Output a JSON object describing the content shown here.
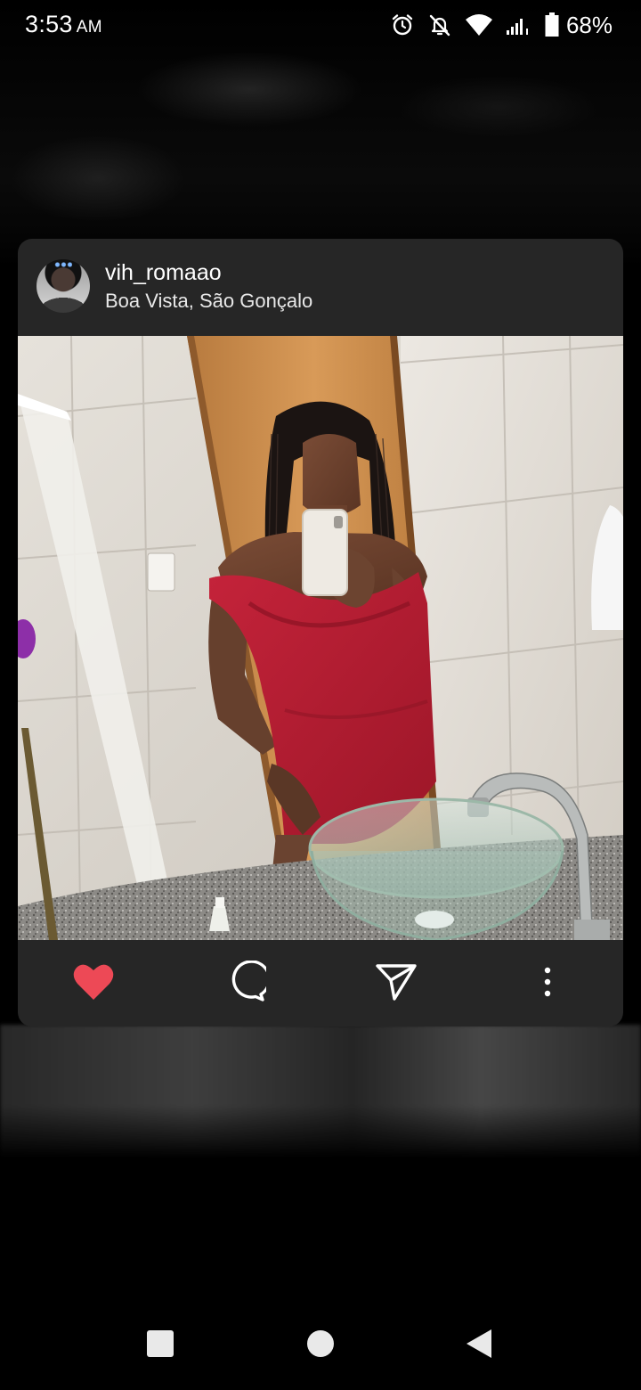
{
  "status_bar": {
    "time": "3:53",
    "ampm": "AM",
    "battery_percent": "68%",
    "icons": [
      "alarm-icon",
      "notifications-off-icon",
      "wifi-icon",
      "signal-icon",
      "battery-icon"
    ]
  },
  "post": {
    "username": "vih_romaao",
    "location": "Boa Vista, São Gonçalo",
    "liked": true,
    "actions": [
      "heart-icon",
      "comment-icon",
      "send-icon",
      "more-icon"
    ],
    "like_color": "#ED4956"
  },
  "nav_bar": {
    "buttons": [
      "recents-button",
      "home-button",
      "back-button"
    ]
  },
  "colors": {
    "card_background": "#262626",
    "screen_background": "#000000",
    "dress_red": "#B51E32"
  }
}
